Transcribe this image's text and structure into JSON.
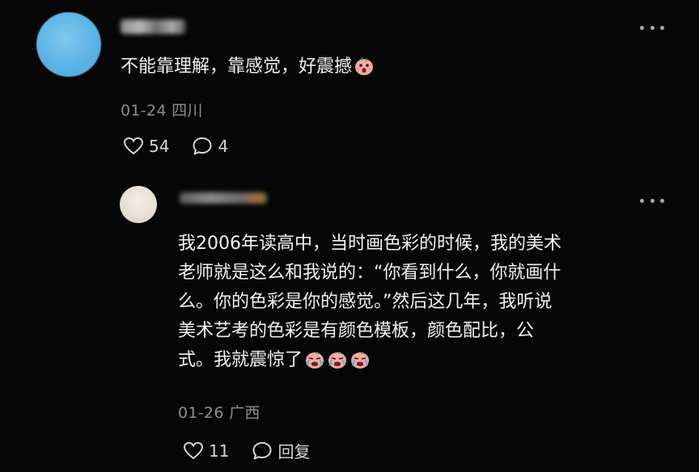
{
  "comment": {
    "text": "不能靠理解，靠感觉，好震撼",
    "emoji": "shocked-face-emoji",
    "date": "01-24",
    "location": "四川",
    "likes": "54",
    "replies": "4"
  },
  "reply": {
    "text": "我2006年读高中，当时画色彩的时候，我的美术\n老师就是这么和我说的：“你看到什么，你就画什\n么。你的色彩是你的感觉。”然后这几年，我听说\n美术艺考的色彩是有颜色模板，颜色配比，公\n式。我就震惊了",
    "emoji": "crying-face-emoji",
    "date": "01-26",
    "location": "广西",
    "likes": "11",
    "reply_label": "回复"
  },
  "colors": {
    "background": "#060606",
    "text": "#f2f2f2",
    "meta": "#8d8d8d"
  }
}
